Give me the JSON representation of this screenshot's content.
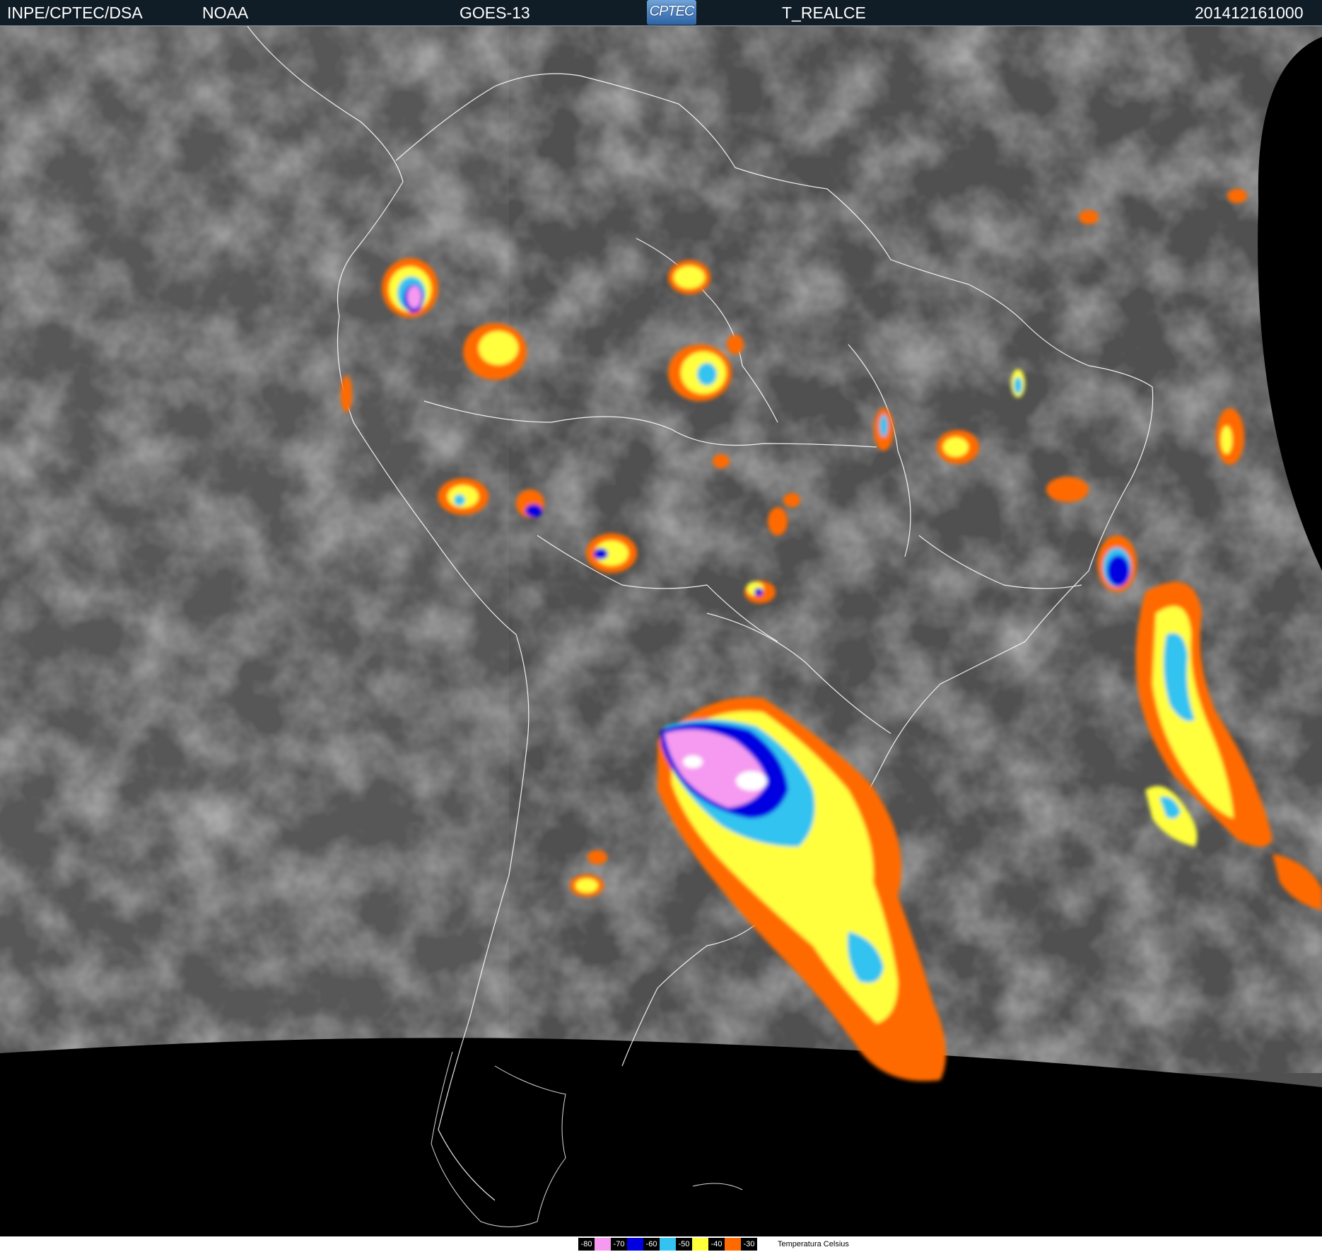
{
  "header": {
    "org": "INPE/CPTEC/DSA",
    "agency": "NOAA",
    "satellite": "GOES-13",
    "logo_text": "CPTEC",
    "product": "T_REALCE",
    "timestamp": "201412161000"
  },
  "map": {
    "region": "South America",
    "background_colors": {
      "clouds_dark": "#3a3a3a",
      "clouds_mid": "#6a6a6a",
      "space": "#000000",
      "borders": "#ffffff"
    }
  },
  "legend": {
    "title": "Temperatura   Celsius",
    "items": [
      {
        "label": "-80",
        "color": "#ffffff"
      },
      {
        "label": "-70",
        "color": "#f59af0"
      },
      {
        "label": "-60",
        "color": "#0000e0"
      },
      {
        "label": "-50",
        "color": "#33c3f0"
      },
      {
        "label": "-40",
        "color": "#ffff3c"
      },
      {
        "label": "-30",
        "color": "#ff6a00"
      }
    ]
  }
}
